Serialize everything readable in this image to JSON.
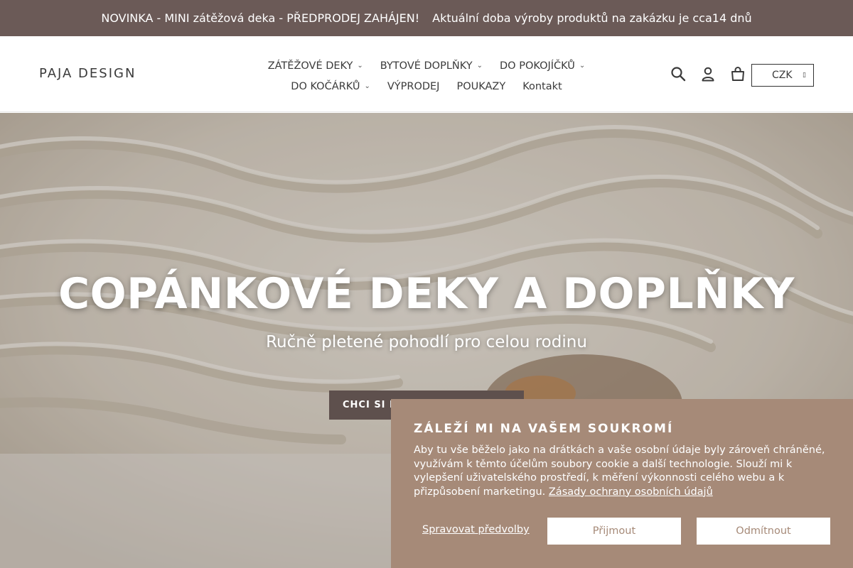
{
  "announcement": {
    "left": "NOVINKA - MINI zátěžová deka - PŘEDPRODEJ ZAHÁJEN!",
    "right": "Aktuální doba výroby produktů na zakázku je cca14 dnů"
  },
  "header": {
    "logo": "PAJA DESIGN",
    "nav_row1": [
      "ZÁTĚŽOVÉ DEKY",
      "BYTOVÉ DOPLŇKY",
      "DO POKOJÍČKŮ"
    ],
    "nav_row2": [
      "DO KOČÁRKŮ",
      "VÝPRODEJ",
      "POUKAZY",
      "Kontakt"
    ],
    "currency": "CZK",
    "icons": [
      "search-icon",
      "account-icon",
      "cart-icon"
    ]
  },
  "hero": {
    "title": "COPÁNKOVÉ DEKY A DOPLŇKY",
    "subtitle": "Ručně pletené pohodlí pro celou rodinu",
    "button": "CHCI SI P"
  },
  "cookie": {
    "title": "ZÁLEŽÍ MI NA VAŠEM SOUKROMÍ",
    "text": "Aby tu vše běželo jako na drátkách a vaše osobní údaje byly zároveň chráněné, využívám k těmto účelům soubory cookie a další technologie. Slouží mi k vylepšení uživatelského prostředí, k měření výkonnosti celého webu a k přizpůsobení marketingu.",
    "link": "Zásady ochrany osobních údajů",
    "manage": "Spravovat předvolby",
    "accept": "Přijmout",
    "decline": "Odmítnout"
  },
  "colors": {
    "announcement_bg": "#6b5a57",
    "cookie_bg": "#a68a78",
    "button_bg": "#5e504d"
  }
}
